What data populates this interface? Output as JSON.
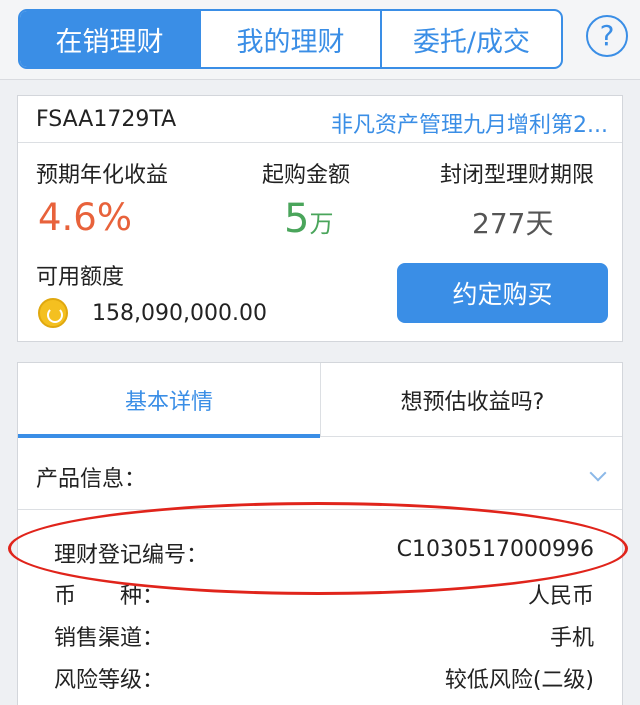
{
  "tabs": {
    "t1": "在销理财",
    "t2": "我的理财",
    "t3": "委托/成交",
    "help": "?"
  },
  "product": {
    "code": "FSAA1729TA",
    "name": "非凡资产管理九月增利第2...",
    "rate_label": "预期年化收益",
    "rate": "4.6%",
    "minbuy_label": "起购金额",
    "minbuy_num": "5",
    "minbuy_unit": "万",
    "term_label": "封闭型理财期限",
    "term": "277天",
    "avail_label": "可用额度",
    "avail": "158,090,000.00",
    "buy_button": "约定购买"
  },
  "details": {
    "tab_basic": "基本详情",
    "tab_estimate": "想预估收益吗?",
    "product_info": "产品信息：",
    "rows": [
      {
        "label": "理财登记编号：",
        "value": "C1030517000996"
      },
      {
        "label": "币　　种：",
        "value": "人民币"
      },
      {
        "label": "销售渠道：",
        "value": "手机"
      },
      {
        "label": "风险等级：",
        "value": "较低风险(二级)"
      }
    ]
  },
  "colors": {
    "accent": "#3a8ee6",
    "rate": "#e8623b",
    "minbuy": "#4aa55b",
    "highlight": "#e0241b"
  }
}
